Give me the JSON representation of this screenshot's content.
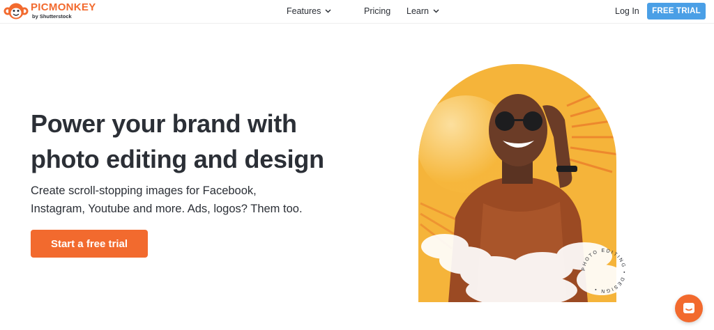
{
  "brand": {
    "name": "PICMONKEY",
    "sub": "by Shutterstock",
    "accent": "#f26a2e",
    "button_blue": "#4a9fe6"
  },
  "nav": {
    "features": "Features",
    "pricing": "Pricing",
    "learn": "Learn"
  },
  "header": {
    "login": "Log In",
    "free_trial": "FREE TRIAL"
  },
  "hero": {
    "headline": "Power your brand with photo editing and design",
    "subtext": "Create scroll-stopping images for Facebook, Instagram, Youtube and more. Ads, logos? Them too.",
    "cta": "Start a free trial",
    "badge_text": "PHOTO EDITING • DESIGN •"
  },
  "icons": {
    "logo": "monkey-logo-icon",
    "dropdown": "chevron-down-icon",
    "chat": "chat-icon"
  }
}
